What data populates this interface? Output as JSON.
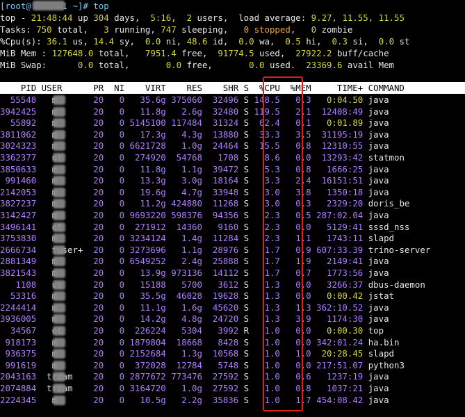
{
  "prompt": {
    "text": "[root@",
    "host_mask": "      ",
    "suffix": "1 ~]# ",
    "cmd": "top"
  },
  "summary": {
    "l1": {
      "a": "top - ",
      "time": "21:48:44",
      "b": " up ",
      "days": "304",
      "c": " days,  ",
      "up": "5:16",
      "d": ",  ",
      "users": "2",
      "e": " users,  load average: ",
      "la": "9.27, 11.55, 11.55"
    },
    "l2": {
      "a": "Tasks: ",
      "total": "750",
      "b": " total,   ",
      "run": "3",
      "c": " running, ",
      "sleep": "747",
      "d": " sleeping,   ",
      "stop": "0 stopped",
      "e": ",   ",
      "zombie": "0",
      "f": " zombie"
    },
    "l3": {
      "a": "%Cpu(s): ",
      "us": "36.1",
      "b": " us, ",
      "sy": "14.4",
      "c": " sy,  ",
      "ni": "0.0",
      "d": " ni, ",
      "id": "48.6",
      "e": " id,  ",
      "wa": "0.0",
      "f": " wa,  ",
      "hi": "0.5",
      "g": " hi,  ",
      "si": "0.3",
      "h": " si,  ",
      "st": "0.0",
      "i": " st"
    },
    "l4": {
      "a": "MiB Mem : ",
      "total": "127648.0",
      "b": " total,   ",
      "free": "7951.4",
      "c": " free,  ",
      "used": "91774.5",
      "d": " used,  ",
      "buff": "27922.2",
      "e": " buff/cache"
    },
    "l5": {
      "a": "MiB Swap:      ",
      "total": "0.0",
      "b": " total,       ",
      "free": "0.0",
      "c": " free,       ",
      "used": "0.0",
      "d": " used.  ",
      "avail": "23369.6",
      "e": " avail Mem"
    }
  },
  "header": "    PID USER      PR  NI    VIRT    RES    SHR S  %CPU  %MEM     TIME+ COMMAND",
  "processes": [
    {
      "pid": "55548",
      "user": "  m",
      "pr": "20",
      "ni": "0",
      "virt": "35.6g",
      "res": "375060",
      "shr": "32496",
      "s": "S",
      "cpu": "148.5",
      "mem": "0.3",
      "time": "0:04.50",
      "cmd": "java"
    },
    {
      "pid": "3942425",
      "user": "  m",
      "pr": "20",
      "ni": "0",
      "virt": "11.8g",
      "res": "2.6g",
      "shr": "32480",
      "s": "S",
      "cpu": "119.5",
      "mem": "2.1",
      "time": "12408:49",
      "cmd": "java"
    },
    {
      "pid": "55892",
      "user": "  m",
      "pr": "20",
      "ni": "0",
      "virt": "5145100",
      "res": "117484",
      "shr": "31324",
      "s": "S",
      "cpu": "62.4",
      "mem": "0.1",
      "time": "0:01.89",
      "cmd": "java"
    },
    {
      "pid": "3811062",
      "user": "  m",
      "pr": "20",
      "ni": "0",
      "virt": "17.3g",
      "res": "4.3g",
      "shr": "13880",
      "s": "S",
      "cpu": "33.3",
      "mem": "3.5",
      "time": "31195:19",
      "cmd": "java"
    },
    {
      "pid": "3024323",
      "user": "  m",
      "pr": "20",
      "ni": "0",
      "virt": "6621728",
      "res": "1.0g",
      "shr": "24464",
      "s": "S",
      "cpu": "15.5",
      "mem": "0.8",
      "time": "12310:55",
      "cmd": "java"
    },
    {
      "pid": "3362377",
      "user": "  ot",
      "pr": "20",
      "ni": "0",
      "virt": "274920",
      "res": "54768",
      "shr": "1708",
      "s": "S",
      "cpu": "8.6",
      "mem": "0.0",
      "time": "13293:42",
      "cmd": "statmon"
    },
    {
      "pid": "3850633",
      "user": "  m",
      "pr": "20",
      "ni": "0",
      "virt": "11.8g",
      "res": "1.1g",
      "shr": "39472",
      "s": "S",
      "cpu": "5.3",
      "mem": "0.8",
      "time": "1666:25",
      "cmd": "java"
    },
    {
      "pid": "991460",
      "user": "  m",
      "pr": "20",
      "ni": "0",
      "virt": "13.3g",
      "res": "3.0g",
      "shr": "18164",
      "s": "S",
      "cpu": "3.3",
      "mem": "2.4",
      "time": "16151:51",
      "cmd": "java"
    },
    {
      "pid": "2142053",
      "user": "  m",
      "pr": "20",
      "ni": "0",
      "virt": "19.6g",
      "res": "4.7g",
      "shr": "33948",
      "s": "S",
      "cpu": "3.0",
      "mem": "3.8",
      "time": "1350:18",
      "cmd": "java"
    },
    {
      "pid": "3827237",
      "user": "  m",
      "pr": "20",
      "ni": "0",
      "virt": "11.2g",
      "res": "424880",
      "shr": "11268",
      "s": "S",
      "cpu": "3.0",
      "mem": "0.3",
      "time": "2329:20",
      "cmd": "doris_be"
    },
    {
      "pid": "3142427",
      "user": "  m",
      "pr": "20",
      "ni": "0",
      "virt": "9693220",
      "res": "598376",
      "shr": "94356",
      "s": "S",
      "cpu": "2.3",
      "mem": "0.5",
      "time": "287:02.04",
      "cmd": "java"
    },
    {
      "pid": "3496141",
      "user": "  ot",
      "pr": "20",
      "ni": "0",
      "virt": "271912",
      "res": "14360",
      "shr": "9160",
      "s": "S",
      "cpu": "2.3",
      "mem": "0.0",
      "time": "5129:41",
      "cmd": "sssd_nss"
    },
    {
      "pid": "3753830",
      "user": "  m",
      "pr": "20",
      "ni": "0",
      "virt": "3234124",
      "res": "1.4g",
      "shr": "11284",
      "s": "S",
      "cpu": "2.3",
      "mem": "1.1",
      "time": "1743:11",
      "cmd": "slapd"
    },
    {
      "pid": "2666734",
      "user": "  tuser+",
      "pr": "20",
      "ni": "0",
      "virt": "3273696",
      "res": "1.1g",
      "shr": "28976",
      "s": "S",
      "cpu": "1.7",
      "mem": "0.9",
      "time": "607:33.39",
      "cmd": "trino-server"
    },
    {
      "pid": "2881349",
      "user": "  m",
      "pr": "20",
      "ni": "0",
      "virt": "6549252",
      "res": "2.4g",
      "shr": "25888",
      "s": "S",
      "cpu": "1.7",
      "mem": "1.9",
      "time": "2149:41",
      "cmd": "java"
    },
    {
      "pid": "3821543",
      "user": "  m",
      "pr": "20",
      "ni": "0",
      "virt": "13.9g",
      "res": "973136",
      "shr": "14112",
      "s": "S",
      "cpu": "1.7",
      "mem": "0.7",
      "time": "1773:56",
      "cmd": "java"
    },
    {
      "pid": "1108",
      "user": "  us",
      "pr": "20",
      "ni": "0",
      "virt": "15188",
      "res": "5700",
      "shr": "3612",
      "s": "S",
      "cpu": "1.3",
      "mem": "0.0",
      "time": "3266:37",
      "cmd": "dbus-daemon"
    },
    {
      "pid": "53316",
      "user": "  m",
      "pr": "20",
      "ni": "0",
      "virt": "35.5g",
      "res": "46028",
      "shr": "19628",
      "s": "S",
      "cpu": "1.3",
      "mem": "0.0",
      "time": "0:00.42",
      "cmd": "jstat"
    },
    {
      "pid": "2244414",
      "user": "  m",
      "pr": "20",
      "ni": "0",
      "virt": "11.1g",
      "res": "1.6g",
      "shr": "45620",
      "s": "S",
      "cpu": "1.3",
      "mem": "1.3",
      "time": "362:10.52",
      "cmd": "java"
    },
    {
      "pid": "3936005",
      "user": "  m",
      "pr": "20",
      "ni": "0",
      "virt": "14.2g",
      "res": "4.8g",
      "shr": "24720",
      "s": "S",
      "cpu": "1.3",
      "mem": "3.9",
      "time": "1174:30",
      "cmd": "java"
    },
    {
      "pid": "34567",
      "user": "  ot",
      "pr": "20",
      "ni": "0",
      "virt": "226224",
      "res": "5304",
      "shr": "3992",
      "s": "R",
      "cpu": "1.0",
      "mem": "0.0",
      "time": "0:00.30",
      "cmd": "top"
    },
    {
      "pid": "918173",
      "user": "  m",
      "pr": "20",
      "ni": "0",
      "virt": "1879804",
      "res": "18668",
      "shr": "8428",
      "s": "S",
      "cpu": "1.0",
      "mem": "0.0",
      "time": "342:01.24",
      "cmd": "ha.bin"
    },
    {
      "pid": "936375",
      "user": "  m",
      "pr": "20",
      "ni": "0",
      "virt": "2152684",
      "res": "1.3g",
      "shr": "10568",
      "s": "S",
      "cpu": "1.0",
      "mem": "1.0",
      "time": "20:28.45",
      "cmd": "slapd"
    },
    {
      "pid": "991619",
      "user": "  m",
      "pr": "20",
      "ni": "0",
      "virt": "372028",
      "res": "12784",
      "shr": "5748",
      "s": "S",
      "cpu": "1.0",
      "mem": "0.0",
      "time": "217:51.07",
      "cmd": "python3"
    },
    {
      "pid": "2043163",
      "user": " tream",
      "pr": "20",
      "ni": "0",
      "virt": "2877672",
      "res": "773476",
      "shr": "27592",
      "s": "S",
      "cpu": "1.0",
      "mem": "0.6",
      "time": "1237:19",
      "cmd": "java"
    },
    {
      "pid": "2074884",
      "user": " tream",
      "pr": "20",
      "ni": "0",
      "virt": "3164720",
      "res": "1.0g",
      "shr": "27592",
      "s": "S",
      "cpu": "1.0",
      "mem": "0.8",
      "time": "1037:21",
      "cmd": "java"
    },
    {
      "pid": "2224345",
      "user": "  m",
      "pr": "20",
      "ni": "0",
      "virt": "10.5g",
      "res": "2.2g",
      "shr": "35836",
      "s": "S",
      "cpu": "1.0",
      "mem": "1.7",
      "time": "454:08.42",
      "cmd": "java"
    }
  ],
  "colors": {
    "background": "#000000",
    "highlight_box": "#e41b1b",
    "prompt": "#6fc8ff",
    "numbers": "#b07cff",
    "summary_values": "#d6d63a",
    "stopped": "#e8a33a"
  }
}
